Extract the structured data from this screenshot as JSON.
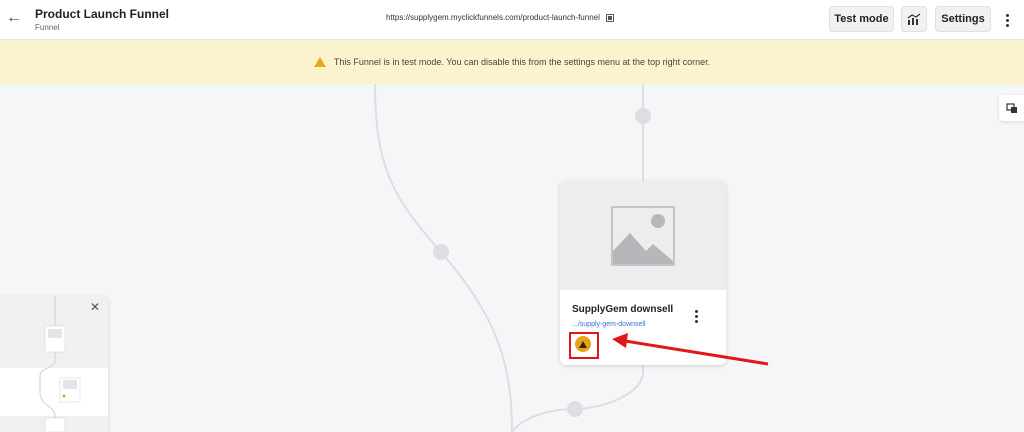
{
  "header": {
    "title": "Product Launch Funnel",
    "subtitle": "Funnel",
    "url": "https://supplygem.myclickfunnels.com/product-launch-funnel",
    "test_mode_label": "Test mode",
    "settings_label": "Settings",
    "back_icon": "arrow-left-icon",
    "copy_icon": "copy-icon",
    "analytics_icon": "analytics-chart-icon",
    "more_icon": "vertical-dots-icon"
  },
  "banner": {
    "text": "This Funnel is in test mode. You can disable this from the settings menu at the top right corner.",
    "icon": "warning-icon",
    "background": "#fbf3cd",
    "icon_color": "#e5a81e"
  },
  "card": {
    "name": "SupplyGem downsell",
    "link": ".../supply-gem-downsell",
    "status_icon": "warning-badge-icon",
    "status_color": "#e6a21a",
    "link_color": "#3e6fd8"
  },
  "annotation": {
    "color": "#e01818"
  },
  "minimap": {
    "close_icon": "close-icon"
  },
  "side_tool": {
    "icon": "page-tools-icon"
  }
}
